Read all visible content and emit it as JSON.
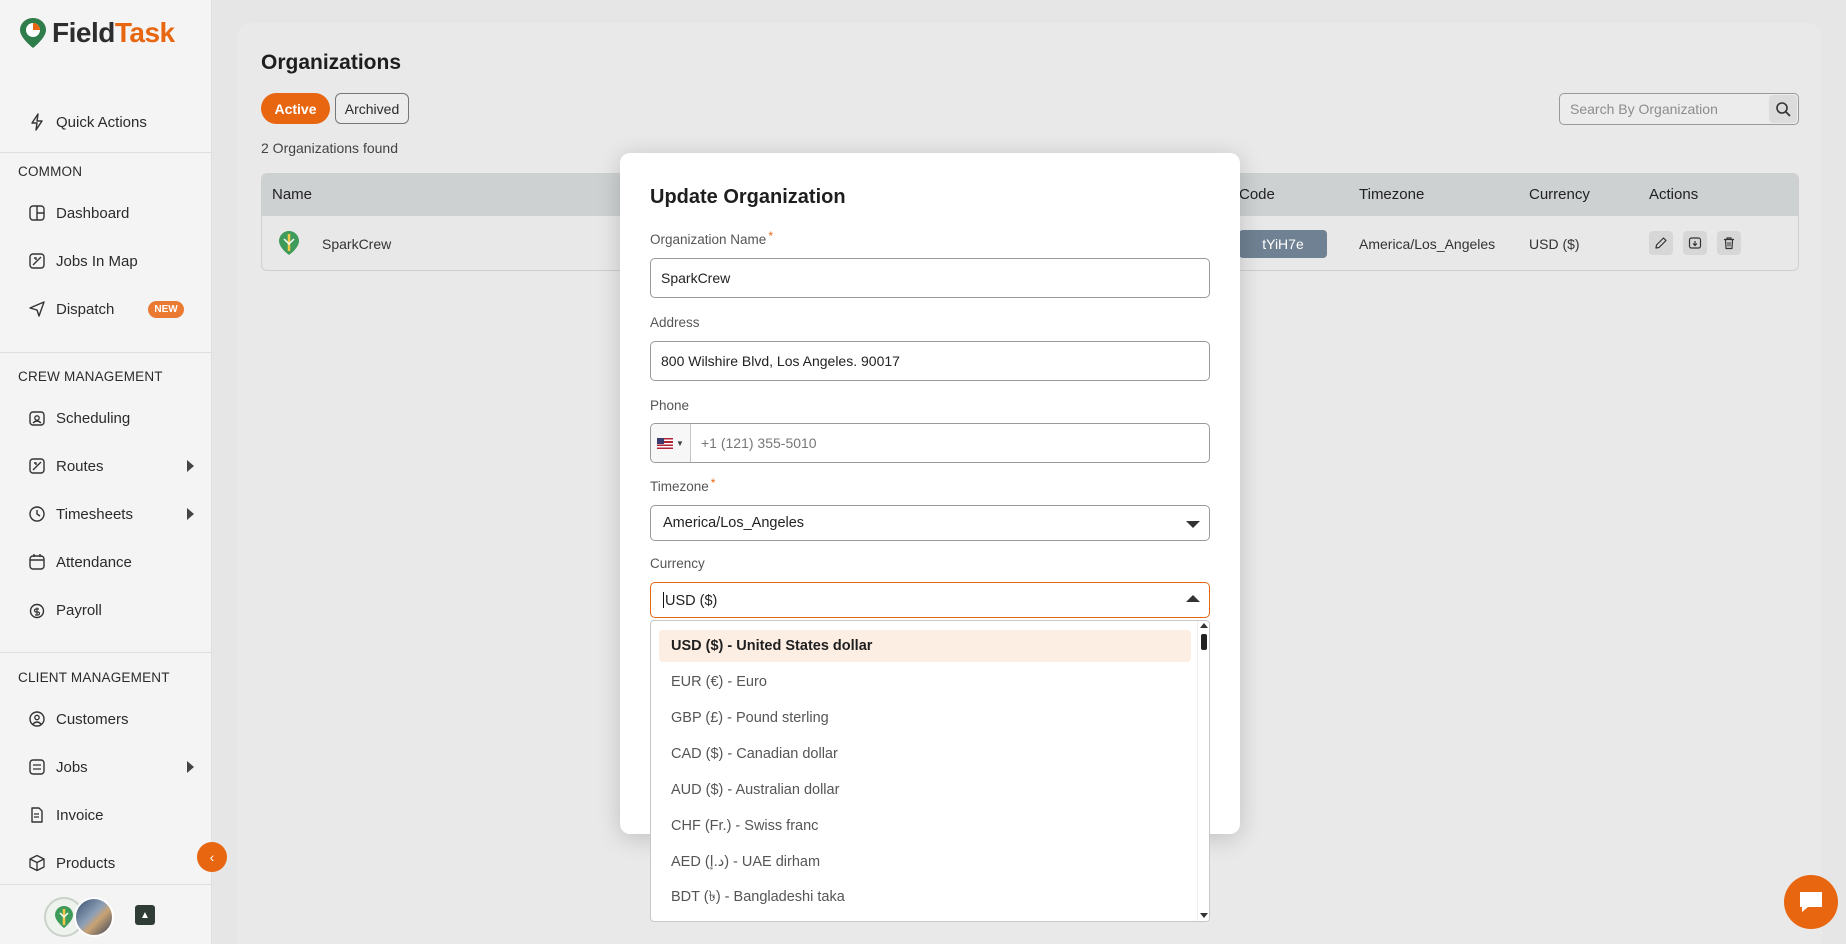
{
  "app": {
    "name_part1": "Field",
    "name_part2": "Task",
    "accent": "#e8660f"
  },
  "sidebar": {
    "quick_actions": "Quick Actions",
    "sections": {
      "common": "COMMON",
      "crew": "CREW MANAGEMENT",
      "client": "CLIENT MANAGEMENT"
    },
    "items": {
      "dashboard": "Dashboard",
      "jobs_in_map": "Jobs In Map",
      "dispatch": "Dispatch",
      "dispatch_badge": "NEW",
      "scheduling": "Scheduling",
      "routes": "Routes",
      "timesheets": "Timesheets",
      "attendance": "Attendance",
      "payroll": "Payroll",
      "customers": "Customers",
      "jobs": "Jobs",
      "invoice": "Invoice",
      "products": "Products"
    }
  },
  "page": {
    "title": "Organizations",
    "filters": {
      "active": "Active",
      "archived": "Archived"
    },
    "found_text": "2 Organizations found",
    "search_placeholder": "Search By Organization"
  },
  "table": {
    "columns": {
      "name": "Name",
      "code": "Code",
      "timezone": "Timezone",
      "currency": "Currency",
      "actions": "Actions"
    },
    "rows": [
      {
        "name": "SparkCrew",
        "code": "tYiH7e",
        "timezone": "America/Los_Angeles",
        "currency": "USD ($)"
      }
    ]
  },
  "modal": {
    "title": "Update Organization",
    "org_name_label": "Organization Name",
    "org_name_value": "SparkCrew",
    "address_label": "Address",
    "address_value": "800 Wilshire Blvd, Los Angeles. 90017",
    "phone_label": "Phone",
    "phone_placeholder": "+1 (121) 355-5010",
    "timezone_label": "Timezone",
    "timezone_value": "America/Los_Angeles",
    "currency_label": "Currency",
    "currency_value": "USD ($)",
    "required_mark": "*"
  },
  "currency_options": [
    "USD ($) - United States dollar",
    "EUR (€) - Euro",
    "GBP (£) - Pound sterling",
    "CAD ($) - Canadian dollar",
    "AUD ($) - Australian dollar",
    "CHF (Fr.) - Swiss franc",
    "AED (د.إ) - UAE dirham",
    "BDT (৳) - Bangladeshi taka"
  ]
}
